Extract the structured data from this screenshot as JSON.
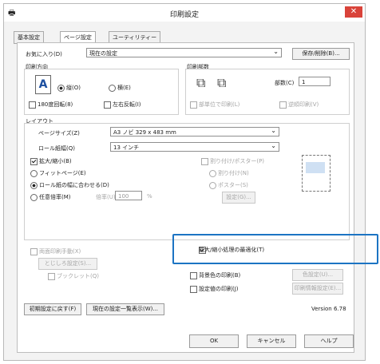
{
  "window": {
    "title": "印刷設定",
    "close_glyph": "✕"
  },
  "tabs": [
    {
      "label": "基本設定"
    },
    {
      "label": "ページ設定"
    },
    {
      "label": "ユーティリティー"
    }
  ],
  "favorites": {
    "label": "お気に入り(D)",
    "value": "現在の設定",
    "save_button": "保存/削除(B)..."
  },
  "orientation": {
    "title": "印刷方向",
    "portrait": "縦(O)",
    "landscape": "横(E)",
    "rotate180": "180度回転(8)",
    "mirror": "左右反転(I)"
  },
  "double_sided": {
    "title": "印刷部数",
    "copies_label": "部数(C)",
    "copies_value": "1",
    "collate": "部単位で印刷(L)",
    "reverse": "逆順印刷(V)"
  },
  "layout": {
    "title": "レイアウト",
    "page_size_label": "ページサイズ(Z)",
    "page_size_value": "A3 ノビ 329 x 483 mm",
    "roll_label": "ロール紙幅(Q)",
    "roll_value": "13 インチ",
    "scale_check": "拡大/縮小(B)",
    "fit_page": "フィットページ(E)",
    "fit_roll": "ロール紙の幅に合わせる(D)",
    "custom_scale": "任意倍率(M)",
    "scale_label": "倍率(U)",
    "scale_value": "100",
    "scale_unit": "%",
    "multi_page": "割り付け/ポスター(P)",
    "nup": "割り付け(N)",
    "poster": "ポスター(S)",
    "settings_button": "設定(G)..."
  },
  "borderless": {
    "label": "両面印刷手動(X)",
    "margin_button": "とじしろ設定(S)...",
    "booklet": "ブックレット(Q)"
  },
  "optimize": {
    "label": "拡大/縮小処理の最適化(T)"
  },
  "background": {
    "label": "背景色の印刷(B)",
    "button": "色設定(U)..."
  },
  "print_info": {
    "label": "設定値の印刷(J)",
    "button": "印刷情報設定(E)..."
  },
  "footer": {
    "reset": "初期設定に戻す(F)",
    "list": "現在の設定一覧表示(W)...",
    "version": "Version 6.78",
    "ok": "OK",
    "cancel": "キャンセル",
    "help": "ヘルプ"
  }
}
